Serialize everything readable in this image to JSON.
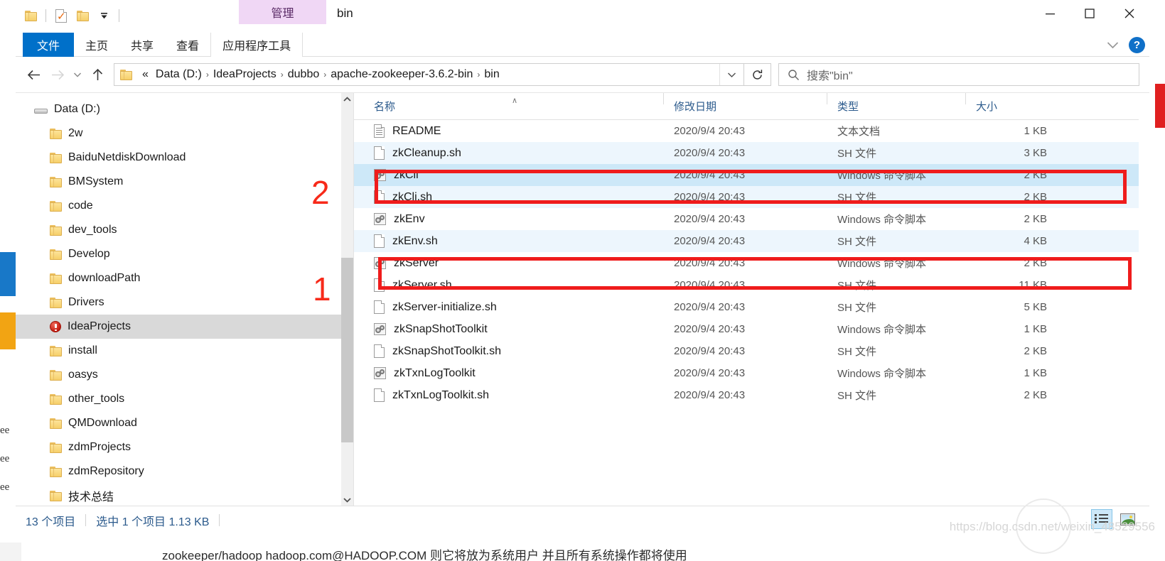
{
  "window": {
    "title": "bin",
    "contextual_tab": "管理",
    "controls": {
      "minimize": "—",
      "maximize": "□",
      "close": "✕"
    },
    "help_label": "?"
  },
  "quick_access": {
    "items": [
      {
        "name": "folder-icon",
        "label": ""
      },
      {
        "name": "properties-icon",
        "label": ""
      },
      {
        "name": "new-folder-icon",
        "label": ""
      },
      {
        "name": "customize-dropdown",
        "label": "▼"
      }
    ]
  },
  "ribbon": {
    "tabs": [
      {
        "label": "文件",
        "active": true
      },
      {
        "label": "主页",
        "active": false
      },
      {
        "label": "共享",
        "active": false
      },
      {
        "label": "查看",
        "active": false
      },
      {
        "label": "应用程序工具",
        "active": false
      }
    ],
    "collapse_icon": "chevron-down-icon",
    "help_icon": "help-icon"
  },
  "address_bar": {
    "back": "←",
    "forward": "→",
    "recent": "⌄",
    "up": "↑",
    "crumbs": [
      "«",
      "Data (D:)",
      "IdeaProjects",
      "dubbo",
      "apache-zookeeper-3.6.2-bin",
      "bin"
    ],
    "separator": "›",
    "dropdown": "⌄",
    "refresh": "↻"
  },
  "search": {
    "placeholder": "搜索\"bin\"",
    "icon": "search-icon"
  },
  "sidebar": {
    "root": {
      "label": "Data (D:)",
      "icon": "drive-icon"
    },
    "items": [
      {
        "label": "2w",
        "icon": "folder-icon",
        "selected": false
      },
      {
        "label": "BaiduNetdiskDownload",
        "icon": "folder-icon",
        "selected": false
      },
      {
        "label": "BMSystem",
        "icon": "folder-icon",
        "selected": false
      },
      {
        "label": "code",
        "icon": "folder-icon",
        "selected": false
      },
      {
        "label": "dev_tools",
        "icon": "folder-icon",
        "selected": false
      },
      {
        "label": "Develop",
        "icon": "folder-icon",
        "selected": false
      },
      {
        "label": "downloadPath",
        "icon": "folder-icon",
        "selected": false
      },
      {
        "label": "Drivers",
        "icon": "folder-icon",
        "selected": false
      },
      {
        "label": "IdeaProjects",
        "icon": "red-drive-icon",
        "selected": true
      },
      {
        "label": "install",
        "icon": "folder-icon",
        "selected": false
      },
      {
        "label": "oasys",
        "icon": "folder-icon",
        "selected": false
      },
      {
        "label": "other_tools",
        "icon": "folder-icon",
        "selected": false
      },
      {
        "label": "QMDownload",
        "icon": "folder-icon",
        "selected": false
      },
      {
        "label": "zdmProjects",
        "icon": "folder-icon",
        "selected": false
      },
      {
        "label": "zdmRepository",
        "icon": "folder-icon",
        "selected": false
      },
      {
        "label": "技术总结",
        "icon": "folder-icon",
        "selected": false
      }
    ]
  },
  "file_list": {
    "columns": [
      "名称",
      "修改日期",
      "类型",
      "大小"
    ],
    "sort_indicator": "∧",
    "rows": [
      {
        "name": "README",
        "date": "2020/9/4 20:43",
        "type": "文本文档",
        "size": "1 KB",
        "icon": "text-document-icon",
        "selected": false,
        "alt": false
      },
      {
        "name": "zkCleanup.sh",
        "date": "2020/9/4 20:43",
        "type": "SH 文件",
        "size": "3 KB",
        "icon": "blank-document-icon",
        "selected": false,
        "alt": true
      },
      {
        "name": "zkCli",
        "date": "2020/9/4 20:43",
        "type": "Windows 命令脚本",
        "size": "2 KB",
        "icon": "command-script-icon",
        "selected": true,
        "alt": false
      },
      {
        "name": "zkCli.sh",
        "date": "2020/9/4 20:43",
        "type": "SH 文件",
        "size": "2 KB",
        "icon": "blank-document-icon",
        "selected": false,
        "alt": true
      },
      {
        "name": "zkEnv",
        "date": "2020/9/4 20:43",
        "type": "Windows 命令脚本",
        "size": "2 KB",
        "icon": "command-script-icon",
        "selected": false,
        "alt": false
      },
      {
        "name": "zkEnv.sh",
        "date": "2020/9/4 20:43",
        "type": "SH 文件",
        "size": "4 KB",
        "icon": "blank-document-icon",
        "selected": false,
        "alt": true
      },
      {
        "name": "zkServer",
        "date": "2020/9/4 20:43",
        "type": "Windows 命令脚本",
        "size": "2 KB",
        "icon": "command-script-icon",
        "selected": false,
        "alt": false
      },
      {
        "name": "zkServer.sh",
        "date": "2020/9/4 20:43",
        "type": "SH 文件",
        "size": "11 KB",
        "icon": "blank-document-icon",
        "selected": false,
        "alt": false
      },
      {
        "name": "zkServer-initialize.sh",
        "date": "2020/9/4 20:43",
        "type": "SH 文件",
        "size": "5 KB",
        "icon": "blank-document-icon",
        "selected": false,
        "alt": false
      },
      {
        "name": "zkSnapShotToolkit",
        "date": "2020/9/4 20:43",
        "type": "Windows 命令脚本",
        "size": "1 KB",
        "icon": "command-script-icon",
        "selected": false,
        "alt": false
      },
      {
        "name": "zkSnapShotToolkit.sh",
        "date": "2020/9/4 20:43",
        "type": "SH 文件",
        "size": "2 KB",
        "icon": "blank-document-icon",
        "selected": false,
        "alt": false
      },
      {
        "name": "zkTxnLogToolkit",
        "date": "2020/9/4 20:43",
        "type": "Windows 命令脚本",
        "size": "1 KB",
        "icon": "command-script-icon",
        "selected": false,
        "alt": false
      },
      {
        "name": "zkTxnLogToolkit.sh",
        "date": "2020/9/4 20:43",
        "type": "SH 文件",
        "size": "2 KB",
        "icon": "blank-document-icon",
        "selected": false,
        "alt": false
      }
    ]
  },
  "status_bar": {
    "item_count": "13 个项目",
    "selection": "选中 1 个项目  1.13 KB",
    "view_details_icon": "details-view-icon",
    "view_large_icons_icon": "large-icons-view-icon"
  },
  "annotations": [
    {
      "label": "2",
      "target": "zkCli"
    },
    {
      "label": "1",
      "target": "zkServer"
    }
  ],
  "background": {
    "bottom_text": "zookeeper/hadoop hadoop.com@HADOOP.COM   则它将放为系统用户   并且所有系统操作都将使用",
    "watermark": "https://blog.csdn.net/weixin_48529556"
  }
}
